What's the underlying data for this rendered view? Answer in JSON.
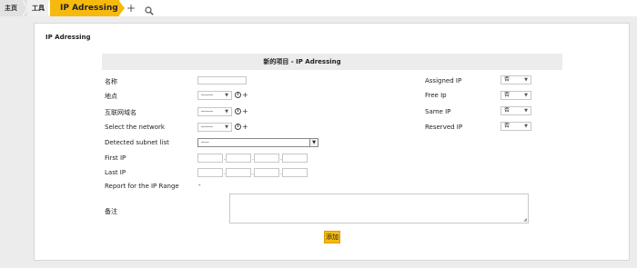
{
  "breadcrumb": {
    "home": "主页",
    "tools": "工具",
    "current": "IP Adressing"
  },
  "toolbar": {
    "add_icon": "plus-icon",
    "search_icon": "search-icon"
  },
  "panel": {
    "title": "IP Adressing",
    "form_header": "新的项目 - IP Adressing"
  },
  "form": {
    "name_label": "名称",
    "location_label": "地点",
    "location_value": "------",
    "internet_domain_label": "互联网域名",
    "internet_domain_value": "------",
    "network_label": "Select the network",
    "network_value": "------",
    "subnet_label": "Detected subnet list",
    "subnet_value": "----",
    "first_ip_label": "First IP",
    "last_ip_label": "Last IP",
    "report_label": "Report for the IP Range",
    "report_value": "-",
    "comment_label": "备注",
    "add_button": "添加",
    "assigned_ip_label": "Assigned IP",
    "assigned_ip_value": "否",
    "free_ip_label": "Free Ip",
    "free_ip_value": "否",
    "same_ip_label": "Same IP",
    "same_ip_value": "否",
    "reserved_ip_label": "Reserved IP",
    "reserved_ip_value": "否"
  },
  "colors": {
    "accent": "#f6b90d",
    "background": "#ececec"
  }
}
